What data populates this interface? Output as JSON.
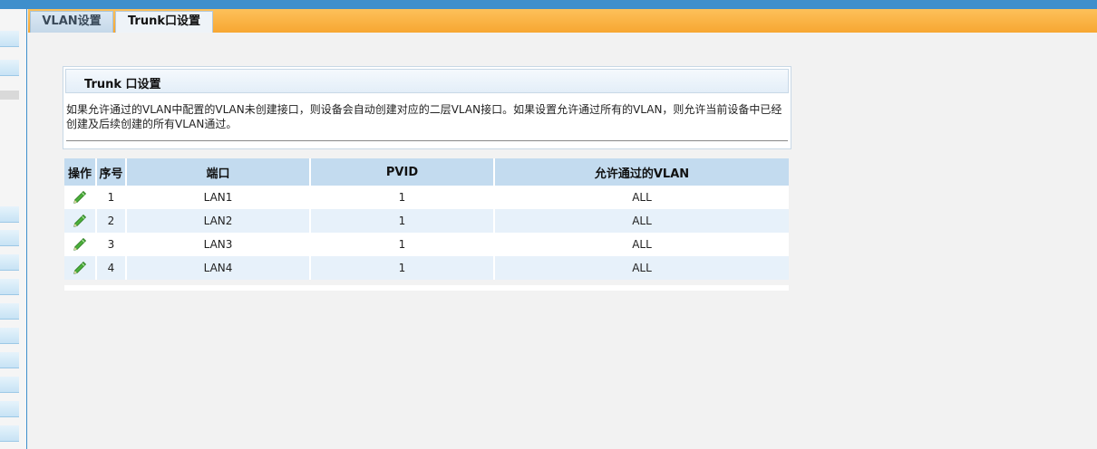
{
  "tabs": [
    {
      "label": "VLAN设置",
      "active": false
    },
    {
      "label": "Trunk口设置",
      "active": true
    }
  ],
  "panel": {
    "title": "Trunk 口设置",
    "description": "如果允许通过的VLAN中配置的VLAN未创建接口，则设备会自动创建对应的二层VLAN接口。如果设置允许通过所有的VLAN，则允许当前设备中已经创建及后续创建的所有VLAN通过。"
  },
  "table": {
    "headers": {
      "action": "操作",
      "index": "序号",
      "port": "端口",
      "pvid": "PVID",
      "allowed_vlan": "允许通过的VLAN"
    },
    "rows": [
      {
        "index": "1",
        "port": "LAN1",
        "pvid": "1",
        "allowed_vlan": "ALL"
      },
      {
        "index": "2",
        "port": "LAN2",
        "pvid": "1",
        "allowed_vlan": "ALL"
      },
      {
        "index": "3",
        "port": "LAN3",
        "pvid": "1",
        "allowed_vlan": "ALL"
      },
      {
        "index": "4",
        "port": "LAN4",
        "pvid": "1",
        "allowed_vlan": "ALL"
      }
    ]
  },
  "colors": {
    "top_bar": "#3f8fcc",
    "tab_bar": "#f7a732",
    "header_bg": "#c3dbef",
    "row_alt": "#e7f1fa",
    "edit_icon": "#3fa33a"
  },
  "icons": {
    "edit": "pencil-edit-icon"
  }
}
